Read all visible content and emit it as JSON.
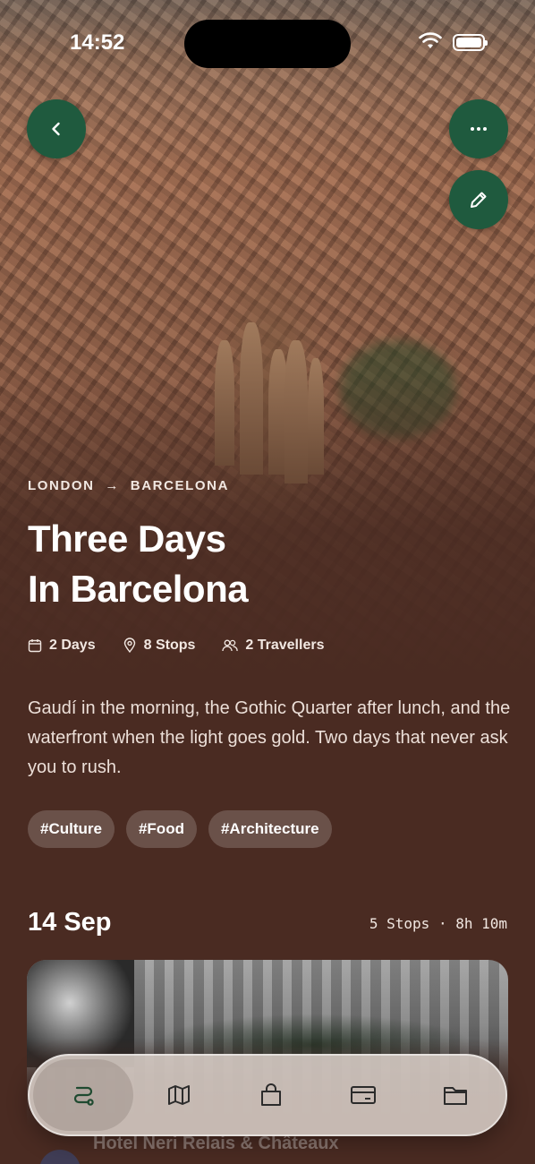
{
  "status_bar": {
    "time": "14:52"
  },
  "trip": {
    "route_from": "LONDON",
    "route_arrow": "→",
    "route_to": "BARCELONA",
    "title_line1": "Three Days",
    "title_line2": "In Barcelona",
    "days": "2 Days",
    "stops": "8 Stops",
    "travellers": "2 Travellers",
    "description": "Gaudí in the morning, the Gothic Quarter after lunch, and the waterfront when the light goes gold. Two days that never ask you to rush.",
    "tags": [
      "#Culture",
      "#Food",
      "#Architecture"
    ]
  },
  "day": {
    "date": "14 Sep",
    "summary": "5 Stops · 8h 10m",
    "first_stop_name": "Hotel Neri Relais & Châteaux"
  },
  "tabbar": {
    "items": [
      "route-icon",
      "map-icon",
      "bag-icon",
      "card-icon",
      "folder-icon"
    ],
    "active_index": 0
  },
  "colors": {
    "background": "#4a2b22",
    "accent_green": "#1f5a3e",
    "tabbar_bg": "#d7cdc6",
    "icon_dark": "#2b2b2b"
  }
}
